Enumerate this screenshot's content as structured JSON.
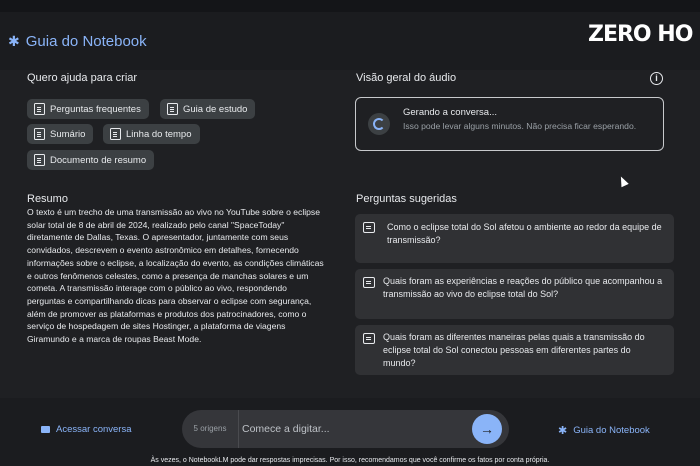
{
  "header": {
    "title": "Guia do Notebook",
    "logo_text": "ZERO HO"
  },
  "help": {
    "title": "Quero ajuda para criar",
    "chips": [
      {
        "label": "Perguntas frequentes",
        "icon": "document-icon"
      },
      {
        "label": "Guia de estudo",
        "icon": "document-icon"
      },
      {
        "label": "Sumário",
        "icon": "document-icon"
      },
      {
        "label": "Linha do tempo",
        "icon": "document-icon"
      },
      {
        "label": "Documento de resumo",
        "icon": "document-icon"
      }
    ]
  },
  "summary": {
    "title": "Resumo",
    "text": "O texto é um trecho de uma transmissão ao vivo no YouTube sobre o eclipse solar total de 8 de abril de 2024, realizado pelo canal \"SpaceToday\" diretamente de Dallas, Texas. O apresentador, juntamente com seus convidados, descrevem o evento astronômico em detalhes, fornecendo informações sobre o eclipse, a localização do evento, as condições climáticas e outros fenômenos celestes, como a presença de manchas solares e um cometa. A transmissão interage com o público ao vivo, respondendo perguntas e compartilhando dicas para observar o eclipse com segurança, além de promover as plataformas e produtos dos patrocinadores, como o serviço de hospedagem de sites Hostinger, a plataforma de viagens Giramundo e a marca de roupas Beast Mode."
  },
  "audio": {
    "title": "Visão geral do áudio",
    "info_icon": "i",
    "status": "Gerando a conversa...",
    "detail": "Isso pode levar alguns minutos. Não precisa ficar esperando."
  },
  "suggested": {
    "title": "Perguntas sugeridas",
    "questions": [
      "Como o eclipse total do Sol afetou o ambiente ao redor da equipe de transmissão?",
      "Quais foram as experiências e reações do público que acompanhou a transmissão ao vivo do eclipse total do Sol?",
      "Quais foram as diferentes maneiras pelas quais a transmissão do eclipse total do Sol conectou pessoas em diferentes partes do mundo?"
    ]
  },
  "footer": {
    "chat_link": "Acessar conversa",
    "sources": "5 origens",
    "placeholder": "Comece a digitar...",
    "send_icon": "→",
    "guide_link": "Guia do Notebook",
    "disclaimer": "Às vezes, o NotebookLM pode dar respostas imprecisas. Por isso, recomendamos que você confirme os fatos por conta própria."
  },
  "colors": {
    "background": "#202124",
    "accent": "#8ab4f8",
    "card": "#303134",
    "chip": "#3c4043"
  }
}
